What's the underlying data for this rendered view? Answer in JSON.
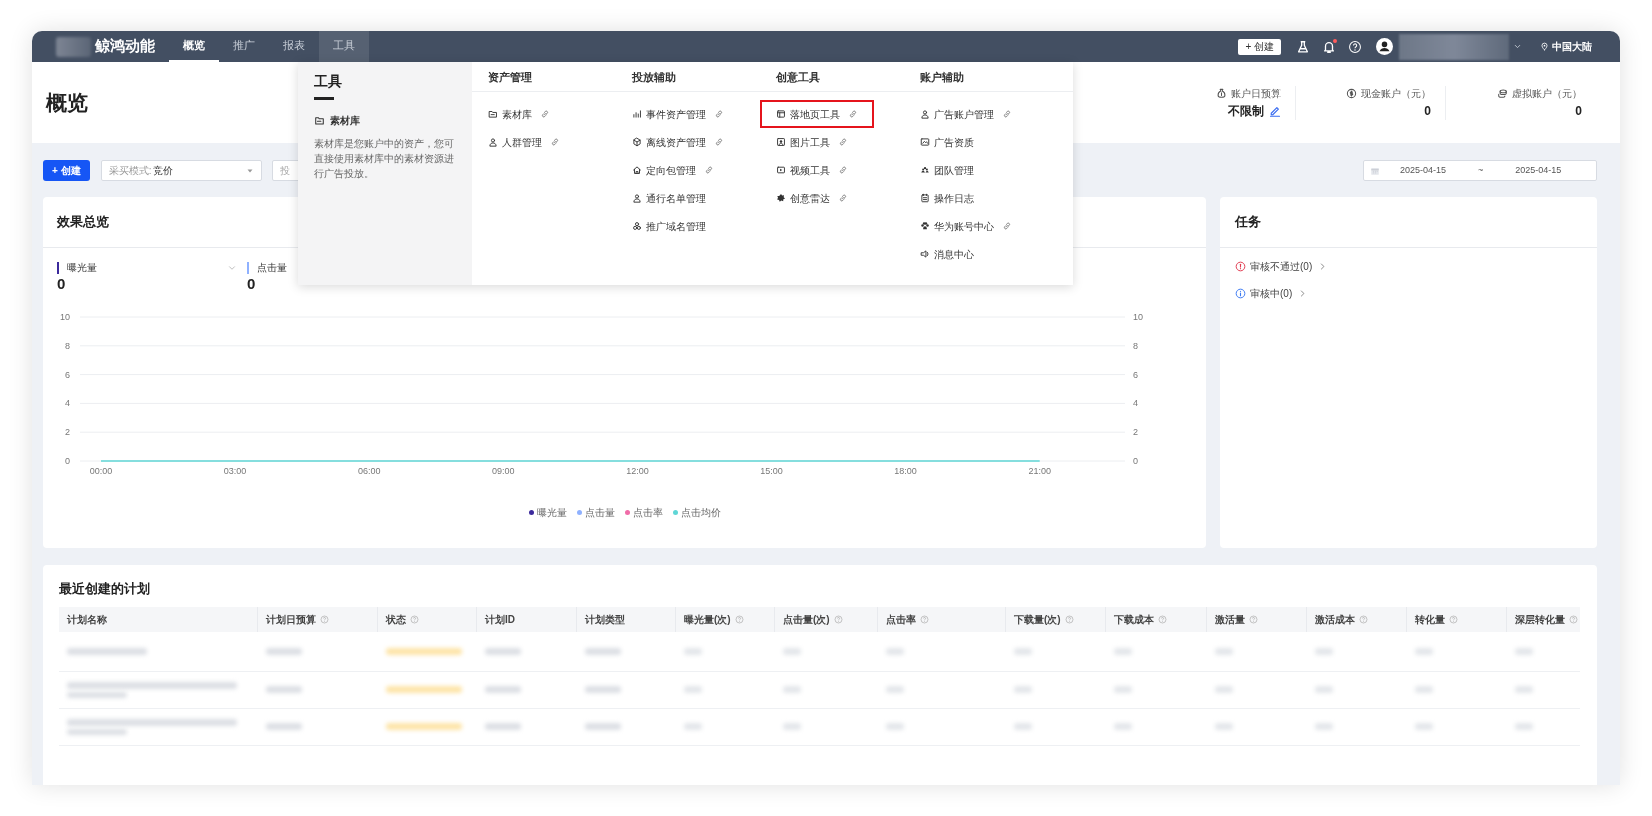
{
  "top_bar": {
    "brand": "鲸鸿动能",
    "nav": [
      {
        "label": "概览",
        "selected": true,
        "expanded": false
      },
      {
        "label": "推广",
        "selected": false,
        "expanded": false
      },
      {
        "label": "报表",
        "selected": false,
        "expanded": false
      },
      {
        "label": "工具",
        "selected": false,
        "expanded": true
      }
    ],
    "create_button": "+ 创建",
    "notification_dot": true,
    "region": "中国大陆"
  },
  "page_header": {
    "title": "概览",
    "stats": [
      {
        "label": "账户日预算",
        "value": "不限制",
        "editable": true
      },
      {
        "label": "现金账户（元）",
        "value": "0",
        "editable": false
      },
      {
        "label": "虚拟账户（元）",
        "value": "0",
        "editable": false
      }
    ]
  },
  "toolbar": {
    "create_button": "+ 创建",
    "buying_mode": {
      "label": "采买模式:",
      "value": "竞价"
    },
    "second_filter": {
      "placeholder": "投"
    },
    "date_range": {
      "start": "2025-04-15",
      "separator": "~",
      "end": "2025-04-15"
    }
  },
  "overview": {
    "title": "效果总览",
    "metrics": [
      {
        "label": "曝光量",
        "value": "0",
        "color": "#3b2a9c"
      },
      {
        "label": "点击量",
        "value": "0",
        "color": "#8fb1ff"
      }
    ],
    "chart_data": {
      "type": "line",
      "categories": [
        "00:00",
        "03:00",
        "06:00",
        "09:00",
        "12:00",
        "15:00",
        "18:00",
        "21:00"
      ],
      "ylim": [
        0,
        10
      ],
      "yticks": [
        0,
        2,
        4,
        6,
        8,
        10
      ],
      "y2ticks": [
        0,
        2,
        4,
        6,
        8,
        10
      ],
      "y2lim": [
        0,
        10
      ],
      "grid": true,
      "series": [
        {
          "name": "曝光量",
          "color": "#3b2a9c",
          "values": [
            null,
            null,
            null,
            null,
            null,
            null,
            null,
            null
          ]
        },
        {
          "name": "点击量",
          "color": "#8fb1ff",
          "values": [
            null,
            null,
            null,
            null,
            null,
            null,
            null,
            null
          ]
        },
        {
          "name": "点击率",
          "color": "#f06ca8",
          "values": [
            null,
            null,
            null,
            null,
            null,
            null,
            null,
            null
          ]
        },
        {
          "name": "点击均价",
          "color": "#5fd6d6",
          "values": [
            0,
            0,
            0,
            0,
            0,
            0,
            0,
            0
          ]
        }
      ]
    }
  },
  "tasks": {
    "title": "任务",
    "items": [
      {
        "label": "审核不通过(0)",
        "kind": "error"
      },
      {
        "label": "审核中(0)",
        "kind": "info"
      }
    ]
  },
  "recent_plans": {
    "title": "最近创建的计划",
    "columns": [
      {
        "label": "计划名称",
        "help": false
      },
      {
        "label": "计划日预算",
        "help": true
      },
      {
        "label": "状态",
        "help": true
      },
      {
        "label": "计划ID",
        "help": false
      },
      {
        "label": "计划类型",
        "help": false
      },
      {
        "label": "曝光量(次)",
        "help": true
      },
      {
        "label": "点击量(次)",
        "help": true
      },
      {
        "label": "点击率",
        "help": true
      },
      {
        "label": "下载量(次)",
        "help": true
      },
      {
        "label": "下载成本",
        "help": true
      },
      {
        "label": "激活量",
        "help": true
      },
      {
        "label": "激活成本",
        "help": true
      },
      {
        "label": "转化量",
        "help": true
      },
      {
        "label": "深层转化量",
        "help": true
      }
    ],
    "rows": [
      {
        "kind": "short"
      },
      {
        "kind": "long"
      },
      {
        "kind": "long"
      }
    ]
  },
  "tools_menu": {
    "title": "工具",
    "featured": {
      "label": "素材库",
      "description": "素材库是您账户中的资产，您可直接使用素材库中的素材资源进行广告投放。"
    },
    "columns": [
      {
        "heading": "资产管理",
        "items": [
          {
            "label": "素材库",
            "link": true,
            "highlighted": false
          },
          {
            "label": "人群管理",
            "link": true,
            "highlighted": false
          }
        ]
      },
      {
        "heading": "投放辅助",
        "items": [
          {
            "label": "事件资产管理",
            "link": true,
            "highlighted": false
          },
          {
            "label": "离线资产管理",
            "link": true,
            "highlighted": false
          },
          {
            "label": "定向包管理",
            "link": true,
            "highlighted": false
          },
          {
            "label": "通行名单管理",
            "link": false,
            "highlighted": false
          },
          {
            "label": "推广域名管理",
            "link": false,
            "highlighted": false
          }
        ]
      },
      {
        "heading": "创意工具",
        "items": [
          {
            "label": "落地页工具",
            "link": true,
            "highlighted": true
          },
          {
            "label": "图片工具",
            "link": true,
            "highlighted": false
          },
          {
            "label": "视频工具",
            "link": true,
            "highlighted": false
          },
          {
            "label": "创意雷达",
            "link": true,
            "highlighted": false
          }
        ]
      },
      {
        "heading": "账户辅助",
        "items": [
          {
            "label": "广告账户管理",
            "link": true,
            "highlighted": false
          },
          {
            "label": "广告资质",
            "link": false,
            "highlighted": false
          },
          {
            "label": "团队管理",
            "link": false,
            "highlighted": false
          },
          {
            "label": "操作日志",
            "link": false,
            "highlighted": false
          },
          {
            "label": "华为账号中心",
            "link": true,
            "highlighted": false
          },
          {
            "label": "消息中心",
            "link": false,
            "highlighted": false
          }
        ]
      }
    ]
  }
}
